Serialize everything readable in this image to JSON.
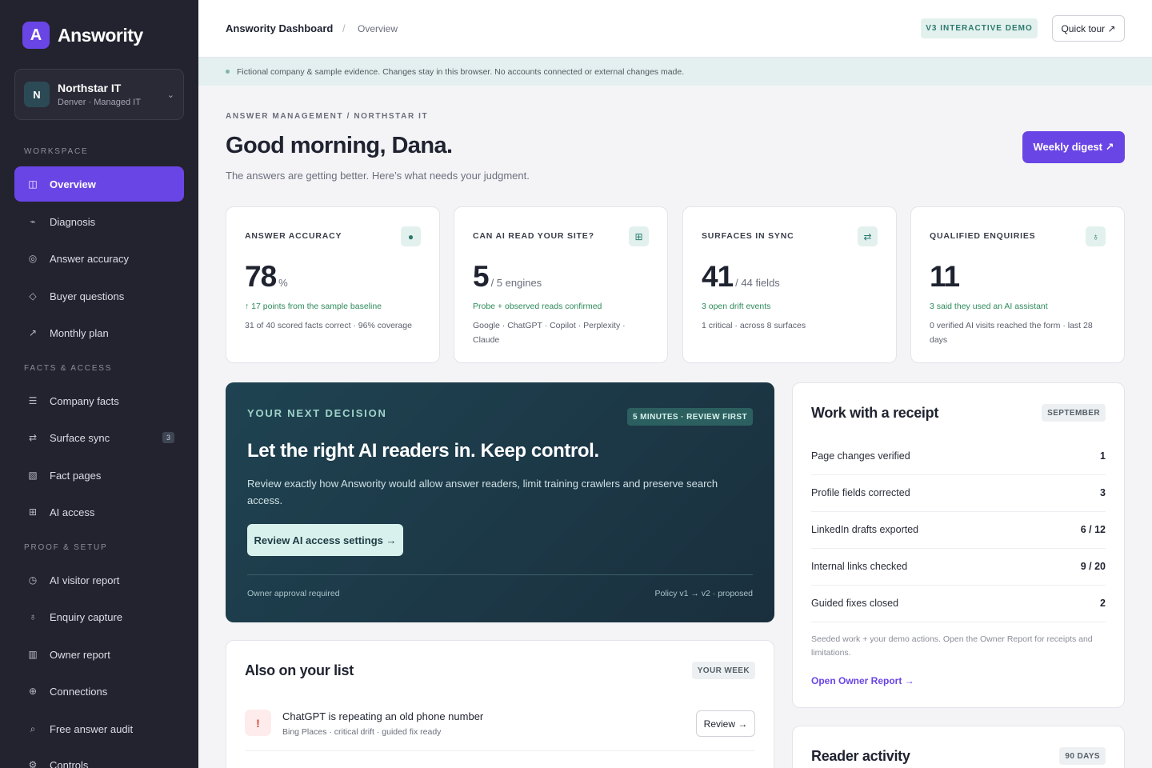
{
  "sidebar": {
    "logo_letter": "A",
    "logo_text": "Answority",
    "org": {
      "avatar": "N",
      "name": "Northstar IT",
      "sub": "Denver · Managed IT"
    },
    "sections": {
      "workspace": "WORKSPACE",
      "facts": "FACTS & ACCESS",
      "proof": "PROOF & SETUP"
    },
    "items": [
      {
        "label": "Overview",
        "icon": "columns-icon"
      },
      {
        "label": "Diagnosis",
        "icon": "pulse-icon"
      },
      {
        "label": "Answer accuracy",
        "icon": "target-icon"
      },
      {
        "label": "Buyer questions",
        "icon": "diamond-icon"
      },
      {
        "label": "Monthly plan",
        "icon": "arrow-icon"
      },
      {
        "label": "Company facts",
        "icon": "list-icon"
      },
      {
        "label": "Surface sync",
        "icon": "sync-icon",
        "badge": "3"
      },
      {
        "label": "Fact pages",
        "icon": "hatch-icon"
      },
      {
        "label": "AI access",
        "icon": "grid-icon"
      },
      {
        "label": "AI visitor report",
        "icon": "clock-icon"
      },
      {
        "label": "Enquiry capture",
        "icon": "bulb-icon"
      },
      {
        "label": "Owner report",
        "icon": "bars-icon"
      },
      {
        "label": "Connections",
        "icon": "globe-icon"
      },
      {
        "label": "Free answer audit",
        "icon": "search-icon"
      },
      {
        "label": "Controls",
        "icon": "gear-icon"
      }
    ]
  },
  "header": {
    "title": "Answority Dashboard",
    "separator": "/",
    "page": "Overview",
    "demo_badge": "V3 INTERACTIVE DEMO",
    "tour_label": "Quick tour ↗"
  },
  "notice": "Fictional company & sample evidence. Changes stay in this browser. No accounts connected or external changes made.",
  "greeting": {
    "eyebrow": "ANSWER MANAGEMENT / NORTHSTAR IT",
    "title": "Good morning, Dana.",
    "tagline": "The answers are getting better. Here’s what needs your judgment.",
    "digest_label": "Weekly digest ↗"
  },
  "metrics": [
    {
      "label": "ANSWER ACCURACY",
      "icon": "info-icon",
      "value": "78",
      "unit": "%",
      "note": "↑ 17 points from the sample baseline",
      "detail": "31 of 40 scored facts correct · 96% coverage"
    },
    {
      "label": "CAN AI READ YOUR SITE?",
      "icon": "grid-icon",
      "value": "5",
      "unit": "/ 5 engines",
      "note": "Probe + observed reads confirmed",
      "detail": "Google · ChatGPT · Copilot · Perplexity · Claude"
    },
    {
      "label": "SURFACES IN SYNC",
      "icon": "sync-icon",
      "value": "41",
      "unit": "/ 44 fields",
      "note": "3 open drift events",
      "detail": "1 critical · across 8 surfaces"
    },
    {
      "label": "QUALIFIED ENQUIRIES",
      "icon": "bulb-icon",
      "value": "11",
      "unit": "",
      "note": "3 said they used an AI assistant",
      "detail": "0 verified AI visits reached the form · last 28 days"
    }
  ],
  "decision": {
    "eyebrow": "YOUR NEXT DECISION",
    "badge": "5 MINUTES · REVIEW FIRST",
    "title": "Let the right AI readers in. Keep control.",
    "text": "Review exactly how Answority would allow answer readers, limit training crawlers and preserve search access.",
    "button": "Review AI access settings →",
    "foot_left": "Owner approval required",
    "foot_right": "Policy v1 → v2 · proposed"
  },
  "also": {
    "title": "Also on your list",
    "badge": "YOUR WEEK",
    "items": [
      {
        "icon": "!",
        "name": "ChatGPT is repeating an old phone number",
        "sub": "Bing Places · critical drift · guided fix ready",
        "button": "Review →"
      }
    ]
  },
  "receipt": {
    "title": "Work with a receipt",
    "badge": "SEPTEMBER",
    "rows": [
      {
        "label": "Page changes verified",
        "value": "1"
      },
      {
        "label": "Profile fields corrected",
        "value": "3"
      },
      {
        "label": "LinkedIn drafts exported",
        "value": "6 / 12"
      },
      {
        "label": "Internal links checked",
        "value": "9 / 20"
      },
      {
        "label": "Guided fixes closed",
        "value": "2"
      }
    ],
    "foot": "Seeded work + your demo actions. Open the Owner Report for receipts and limitations.",
    "link": "Open Owner Report →"
  },
  "reader": {
    "title": "Reader activity",
    "badge": "90 DAYS"
  },
  "colors": {
    "accent": "#6a45e6",
    "sidebar": "#23232f",
    "teal_panel": "#1f4352",
    "positive": "#2d8a5a"
  }
}
